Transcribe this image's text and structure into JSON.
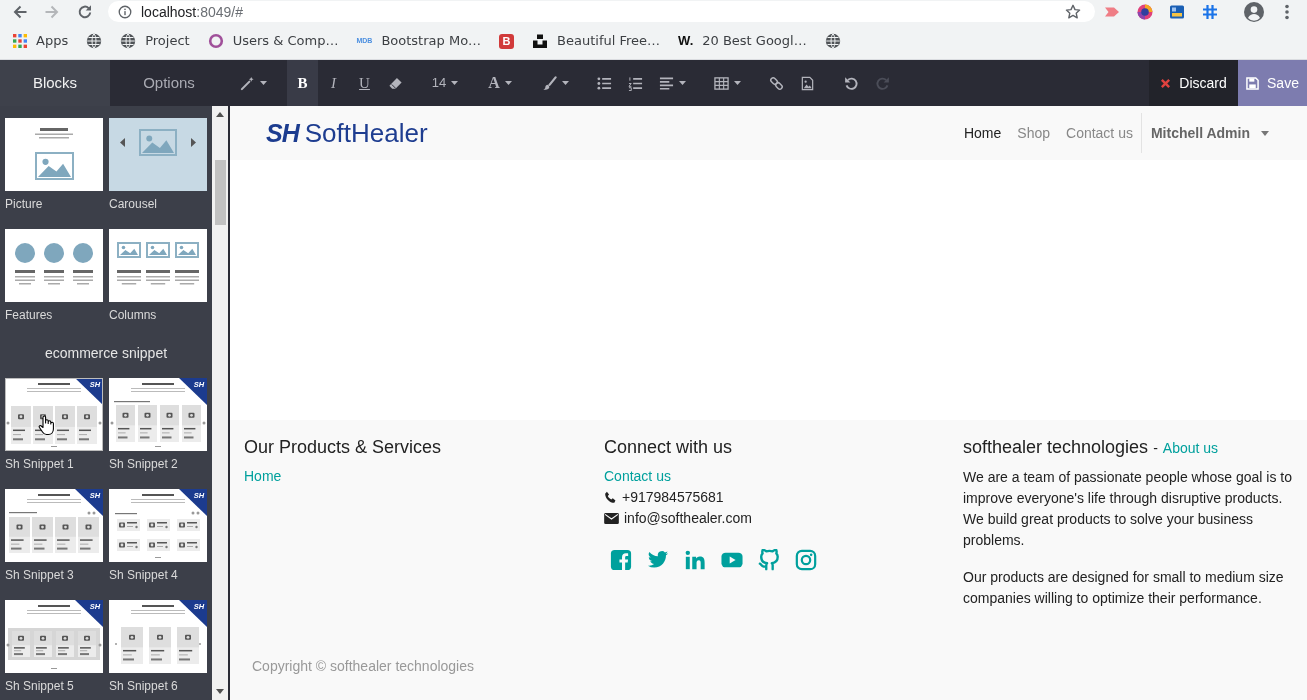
{
  "browser": {
    "url": {
      "host": "localhost",
      "path": ":8049/#"
    },
    "bookmarks": [
      {
        "kind": "apps",
        "label": "Apps"
      },
      {
        "kind": "globe"
      },
      {
        "kind": "globe",
        "label": "Project"
      },
      {
        "kind": "ring",
        "label": "Users & Comp…"
      },
      {
        "kind": "wordmark",
        "icon_text": "MDB",
        "color": "#4b8fe0",
        "label": "Bootstrap Mo…"
      },
      {
        "kind": "tile",
        "icon_text": "B",
        "color": "#d13a3a"
      },
      {
        "kind": "blocks",
        "label": "Beautiful Free…"
      },
      {
        "kind": "letter",
        "icon_text": "W.",
        "color": "#111111",
        "label": "20 Best Googl…"
      },
      {
        "kind": "globe"
      }
    ]
  },
  "editor": {
    "tabs": [
      {
        "label": "Blocks",
        "selected": true
      },
      {
        "label": "Options",
        "selected": false
      }
    ],
    "toolbar": [
      [
        {
          "kind": "wand",
          "dropdown": true,
          "active": false,
          "disabled": false
        }
      ],
      [
        {
          "kind": "bold",
          "label": "B",
          "dropdown": false,
          "active": true,
          "disabled": false
        },
        {
          "kind": "italic",
          "label": "I",
          "dropdown": false,
          "active": false,
          "disabled": false
        },
        {
          "kind": "underline",
          "label": "U",
          "dropdown": false,
          "active": false,
          "disabled": false
        },
        {
          "kind": "eraser",
          "dropdown": false,
          "active": false,
          "disabled": false
        }
      ],
      [
        {
          "kind": "size",
          "label": "14",
          "dropdown": true,
          "active": false,
          "disabled": false
        }
      ],
      [
        {
          "kind": "color",
          "label": "A",
          "dropdown": true,
          "active": false,
          "disabled": false
        }
      ],
      [
        {
          "kind": "brush",
          "dropdown": true,
          "active": false,
          "disabled": false
        }
      ],
      [
        {
          "kind": "bullets",
          "dropdown": false,
          "active": false,
          "disabled": false
        },
        {
          "kind": "numbers",
          "dropdown": false,
          "active": false,
          "disabled": false
        },
        {
          "kind": "align",
          "dropdown": true,
          "active": false,
          "disabled": false
        }
      ],
      [
        {
          "kind": "table",
          "dropdown": true,
          "active": false,
          "disabled": false
        }
      ],
      [
        {
          "kind": "link",
          "dropdown": false,
          "active": false,
          "disabled": false
        },
        {
          "kind": "image",
          "dropdown": false,
          "active": false,
          "disabled": false
        }
      ],
      [
        {
          "kind": "undo",
          "dropdown": false,
          "active": false,
          "disabled": false
        },
        {
          "kind": "redo",
          "dropdown": false,
          "active": false,
          "disabled": true
        }
      ]
    ],
    "discard": "Discard",
    "save": "Save"
  },
  "sidebar": {
    "groups": [
      {
        "snippets": [
          {
            "kind": "picture",
            "label": "Picture",
            "hovered": false
          },
          {
            "kind": "carousel",
            "label": "Carousel",
            "hovered": false
          },
          {
            "kind": "features",
            "label": "Features",
            "hovered": false
          },
          {
            "kind": "columns",
            "label": "Columns",
            "hovered": false
          }
        ]
      },
      {
        "title": "ecommerce snippet",
        "snippets": [
          {
            "kind": "slider",
            "badge": "SH",
            "label": "Sh Snippet 1",
            "hovered": true
          },
          {
            "kind": "gallery",
            "badge": "SH",
            "label": "Sh Snippet 2",
            "hovered": false
          },
          {
            "kind": "grid",
            "badge": "SH",
            "label": "Sh Snippet 3",
            "hovered": false
          },
          {
            "kind": "list",
            "badge": "SH",
            "label": "Sh Snippet 4",
            "hovered": false
          },
          {
            "kind": "boxed",
            "badge": "SH",
            "label": "Sh Snippet 5",
            "hovered": false
          },
          {
            "kind": "trio",
            "badge": "SH",
            "label": "Sh Snippet 6",
            "hovered": false
          }
        ]
      }
    ]
  },
  "site": {
    "logo": {
      "mark": "SH",
      "name": "SoftHealer"
    },
    "nav": [
      {
        "label": "Home",
        "selected": true
      },
      {
        "label": "Shop",
        "selected": false
      },
      {
        "label": "Contact us",
        "selected": false
      }
    ],
    "user": "Mitchell Admin",
    "footer": {
      "products": {
        "title": "Our Products & Services",
        "links": [
          "Home"
        ]
      },
      "connect": {
        "title": "Connect with us",
        "links": [
          "Contact us"
        ],
        "contacts": [
          {
            "kind": "phone",
            "text": "+917984575681"
          },
          {
            "kind": "email",
            "text": "info@softhealer.com"
          }
        ]
      },
      "about": {
        "title": "softhealer technologies",
        "separator": "-",
        "link": "About us",
        "paragraphs": [
          "We are a team of passionate people whose goal is to improve everyone's life through disruptive products. We build great products to solve your business problems.",
          "Our products are designed for small to medium size companies willing to optimize their performance."
        ]
      },
      "copyright": "Copyright © softhealer technologies"
    }
  }
}
